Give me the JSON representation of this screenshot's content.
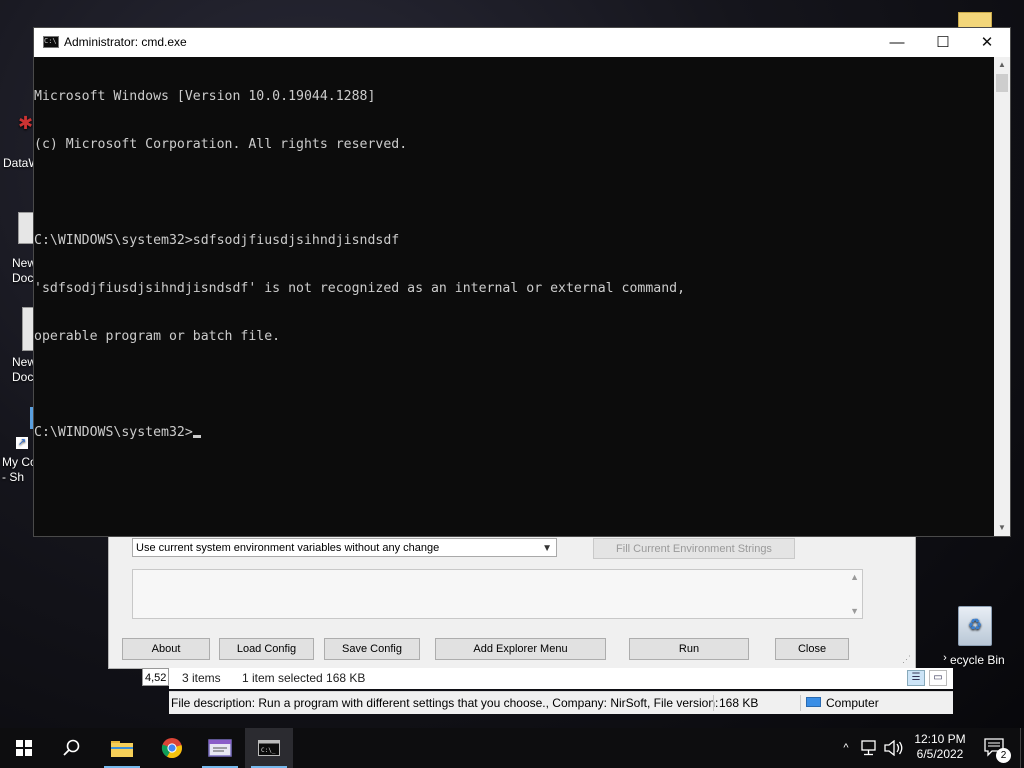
{
  "desktop": {
    "icons": [
      {
        "label": "DataW"
      },
      {
        "label": "New\nDoc"
      },
      {
        "label": "New\nDoc"
      },
      {
        "label": "My Co\n- Sh"
      }
    ],
    "recycle_bin_label": "ecycle Bin"
  },
  "background_window": {
    "combo_value": "Use current system environment variables without any change",
    "fill_button": "Fill Current Environment Strings",
    "buttons": {
      "about": "About",
      "load_config": "Load Config",
      "save_config": "Save Config",
      "add_explorer_menu": "Add Explorer Menu",
      "run": "Run",
      "close": "Close"
    }
  },
  "explorer_status": {
    "left_number": "4,52",
    "items_count": "3 items",
    "selection": "1 item selected  168 KB",
    "description": "File description: Run a program with different settings that you choose., Company: NirSoft, File version:",
    "size": "168 KB",
    "location": "Computer"
  },
  "cmd": {
    "title": "Administrator: cmd.exe",
    "lines": [
      "Microsoft Windows [Version 10.0.19044.1288]",
      "(c) Microsoft Corporation. All rights reserved.",
      "",
      "C:\\WINDOWS\\system32>sdfsodjfiusdjsihndjisndsdf",
      "'sdfsodjfiusdjsihndjisndsdf' is not recognized as an internal or external command,",
      "operable program or batch file.",
      ""
    ],
    "prompt": "C:\\WINDOWS\\system32>"
  },
  "taskbar": {
    "clock_time": "12:10 PM",
    "clock_date": "6/5/2022",
    "notification_count": "2"
  }
}
